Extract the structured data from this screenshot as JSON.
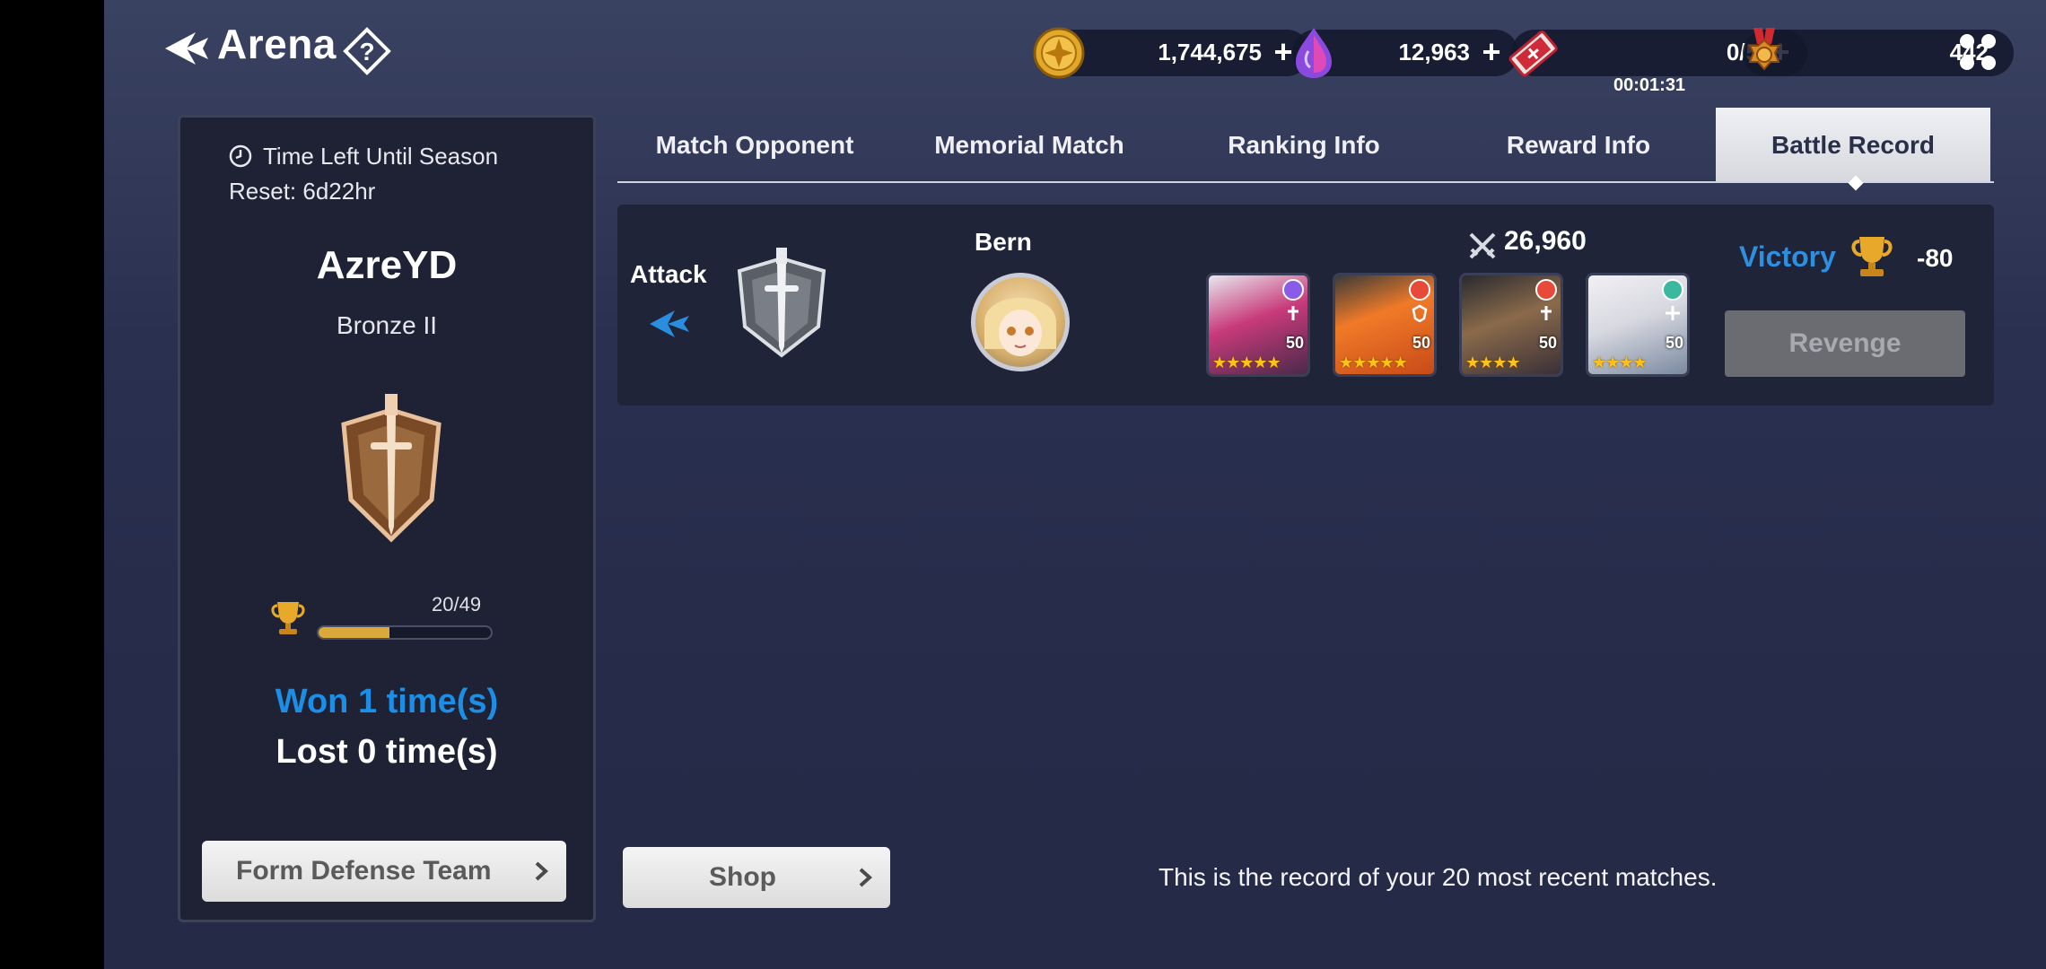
{
  "header": {
    "title": "Arena",
    "currencies": {
      "gold": "1,744,675",
      "gems": "12,963",
      "tickets": "0/5",
      "ticket_timer": "00:01:31",
      "medals": "442"
    }
  },
  "left_panel": {
    "season_timer": "Time Left Until Season Reset: 6d22hr",
    "player_name": "AzreYD",
    "rank": "Bronze II",
    "trophy_progress": "20/49",
    "trophy_progress_fraction": 0.41,
    "won": "Won 1 time(s)",
    "lost": "Lost 0 time(s)",
    "defense_button": "Form Defense Team"
  },
  "tabs": [
    {
      "label": "Match Opponent",
      "active": false
    },
    {
      "label": "Memorial Match",
      "active": false
    },
    {
      "label": "Ranking Info",
      "active": false
    },
    {
      "label": "Reward Info",
      "active": false
    },
    {
      "label": "Battle Record",
      "active": true
    }
  ],
  "record": {
    "type": "Attack",
    "opponent_name": "Bern",
    "opponent_power": "26,960",
    "heroes": [
      {
        "level": "50",
        "stars": "★★★★★"
      },
      {
        "level": "50",
        "stars": "★★★★★"
      },
      {
        "level": "50",
        "stars": "★★★★"
      },
      {
        "level": "50",
        "stars": "★★★★"
      }
    ],
    "result": "Victory",
    "points": "-80",
    "revenge_button": "Revenge"
  },
  "shop_button": "Shop",
  "footer_note": "This is the record of your 20 most recent matches.",
  "colors": {
    "accent_blue": "#1c8ee6",
    "victory_blue": "#2e8fe0",
    "trophy_gold": "#d9a93a"
  }
}
